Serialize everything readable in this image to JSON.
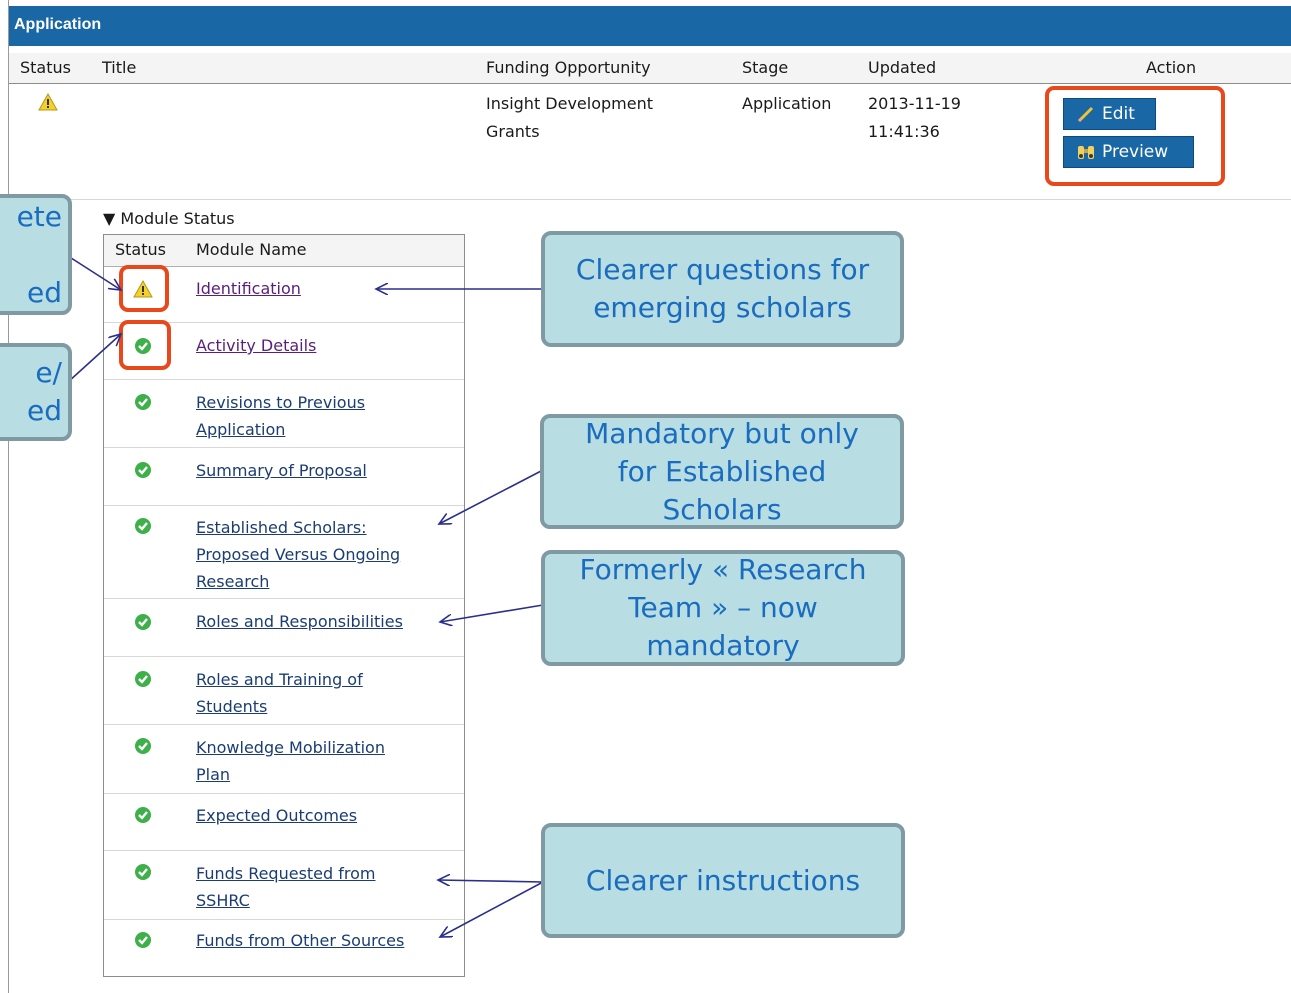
{
  "header": {
    "title": "Application"
  },
  "columns": {
    "status": "Status",
    "title": "Title",
    "funding": "Funding Opportunity",
    "stage": "Stage",
    "updated": "Updated",
    "action": "Action"
  },
  "application_row": {
    "status_icon": "warning-icon",
    "funding_line1": "Insight Development",
    "funding_line2": "Grants",
    "stage": "Application",
    "updated_date": "2013-11-19",
    "updated_time": "11:41:36",
    "edit_label": "Edit",
    "preview_label": "Preview"
  },
  "module_status": {
    "toggle_label": "▼ Module Status",
    "col_status": "Status",
    "col_name": "Module Name",
    "modules": [
      {
        "name_lines": [
          "Identification"
        ],
        "status": "warning-icon"
      },
      {
        "name_lines": [
          "Activity Details"
        ],
        "status": "check-icon"
      },
      {
        "name_lines": [
          "Revisions to Previous",
          "Application"
        ],
        "status": "check-icon"
      },
      {
        "name_lines": [
          "Summary of Proposal"
        ],
        "status": "check-icon"
      },
      {
        "name_lines": [
          "Established Scholars:",
          "Proposed Versus Ongoing",
          "Research"
        ],
        "status": "check-icon"
      },
      {
        "name_lines": [
          "Roles and Responsibilities"
        ],
        "status": "check-icon"
      },
      {
        "name_lines": [
          "Roles and Training of",
          "Students"
        ],
        "status": "check-icon"
      },
      {
        "name_lines": [
          "Knowledge Mobilization",
          "Plan"
        ],
        "status": "check-icon"
      },
      {
        "name_lines": [
          "Expected Outcomes"
        ],
        "status": "check-icon"
      },
      {
        "name_lines": [
          "Funds Requested from",
          "SSHRC"
        ],
        "status": "check-icon"
      },
      {
        "name_lines": [
          "Funds from Other Sources"
        ],
        "status": "check-icon"
      }
    ]
  },
  "callouts": {
    "left_top": [
      "ete",
      "",
      "ed"
    ],
    "left_bottom": [
      "e/",
      "ed"
    ],
    "identification": [
      "Clearer questions for",
      "emerging scholars"
    ],
    "established": [
      "Mandatory but only",
      "for Established",
      "Scholars"
    ],
    "roles": [
      "Formerly « Research",
      "Team » – now",
      "mandatory"
    ],
    "funds": [
      "Clearer instructions"
    ]
  },
  "colors": {
    "header_blue": "#1a67a5",
    "highlight_orange": "#e8491c",
    "callout_fill": "#b8dde3",
    "callout_text": "#1a6cbf",
    "check_green": "#3eb04a",
    "warning_yellow": "#f2d22a",
    "arrow_navy": "#2a2f8c"
  }
}
